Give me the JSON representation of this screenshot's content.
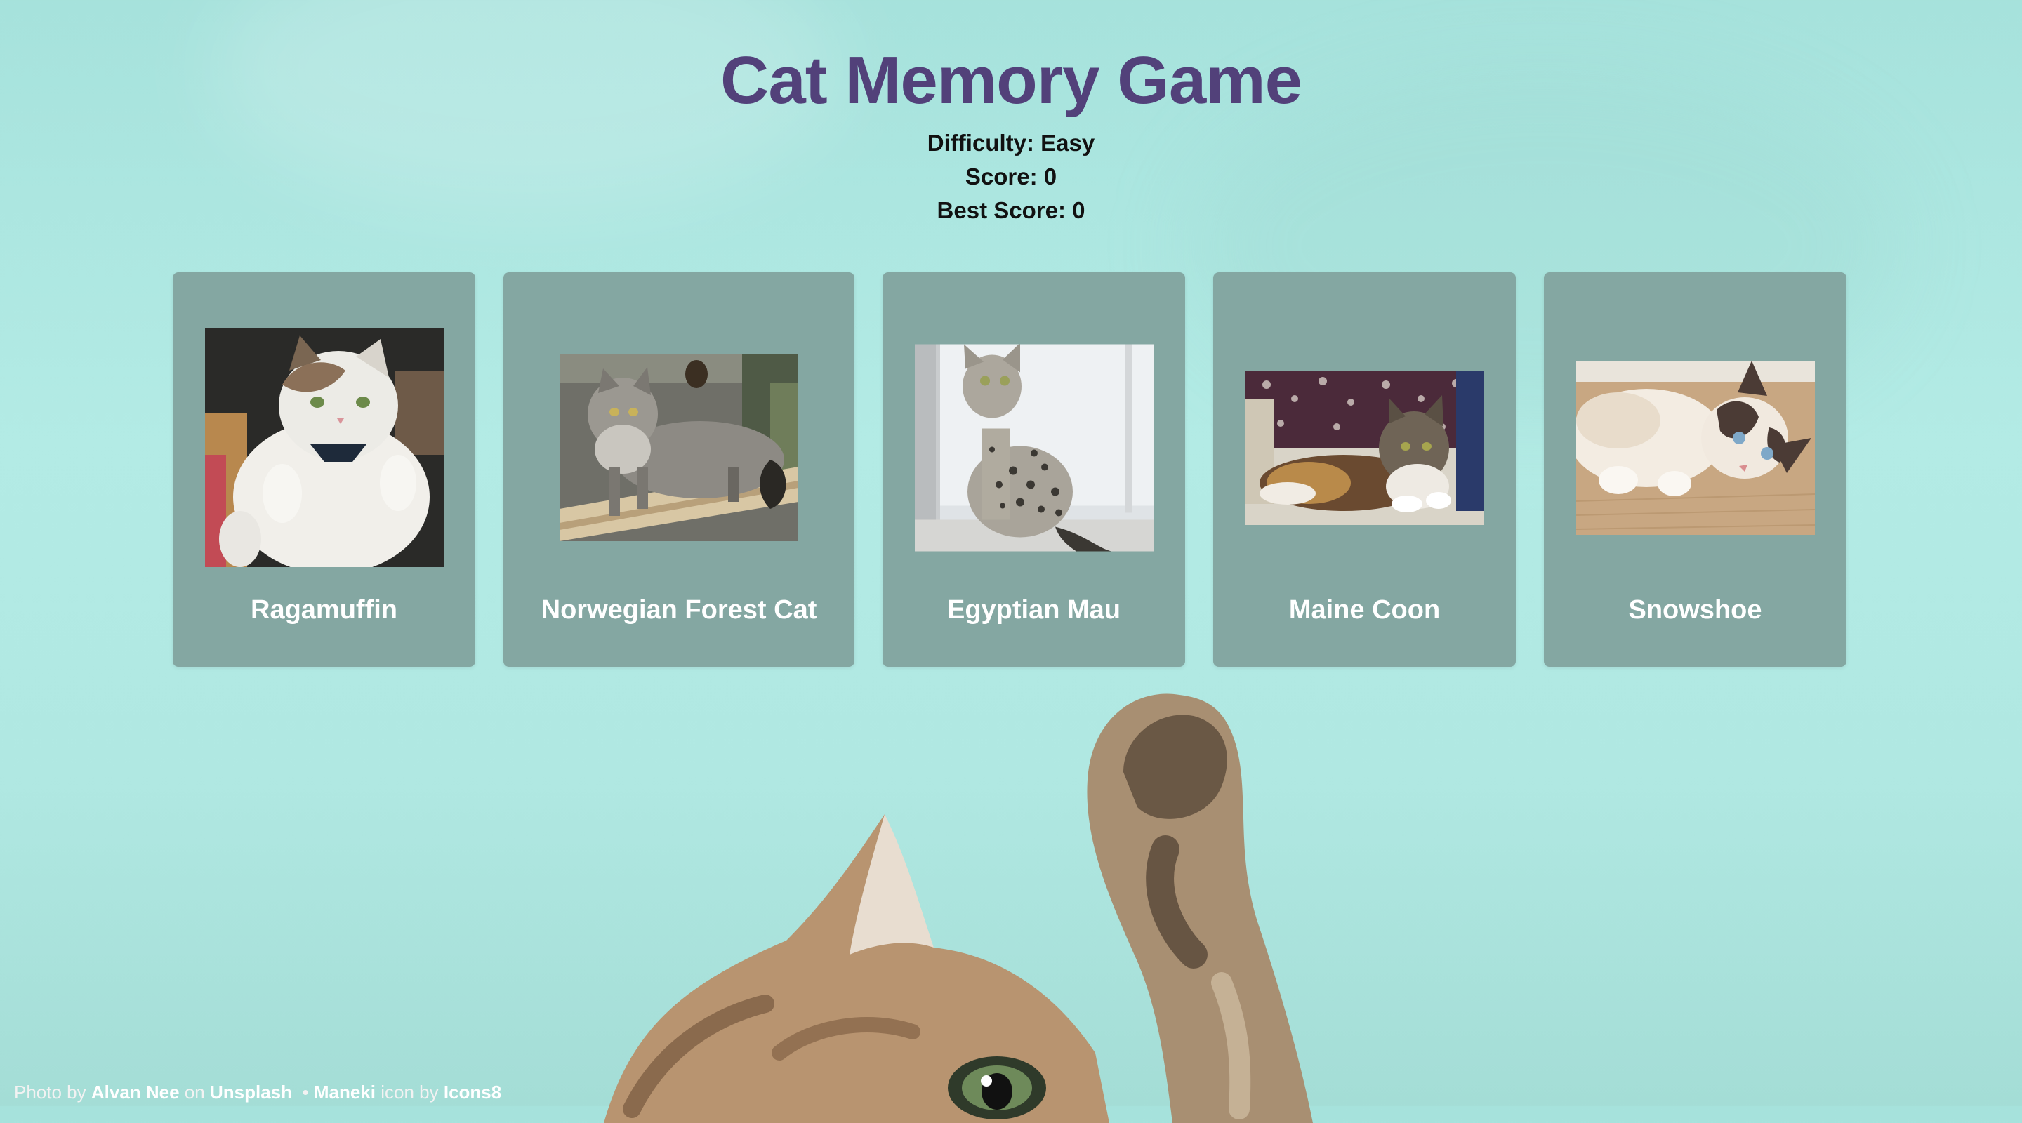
{
  "header": {
    "title": "Cat Memory Game",
    "difficulty": "Difficulty: Easy",
    "score": "Score: 0",
    "best_score": "Best Score: 0"
  },
  "cards": [
    {
      "label": "Ragamuffin",
      "image": "ragamuffin-cat-photo"
    },
    {
      "label": "Norwegian Forest Cat",
      "image": "norwegian-forest-cat-photo"
    },
    {
      "label": "Egyptian Mau",
      "image": "egyptian-mau-cat-photo"
    },
    {
      "label": "Maine Coon",
      "image": "maine-coon-cat-photo"
    },
    {
      "label": "Snowshoe",
      "image": "snowshoe-cat-photo"
    }
  ],
  "footer": {
    "photo_by": "Photo by",
    "photographer": "Alvan Nee",
    "on": "on",
    "site": "Unsplash",
    "separator": "•",
    "icon_name": "Maneki",
    "icon_by": "icon by",
    "icon_site": "Icons8"
  },
  "colors": {
    "title": "#52417a",
    "card_bg": "#84a7a2",
    "page_bg": "#b0e8e2"
  }
}
